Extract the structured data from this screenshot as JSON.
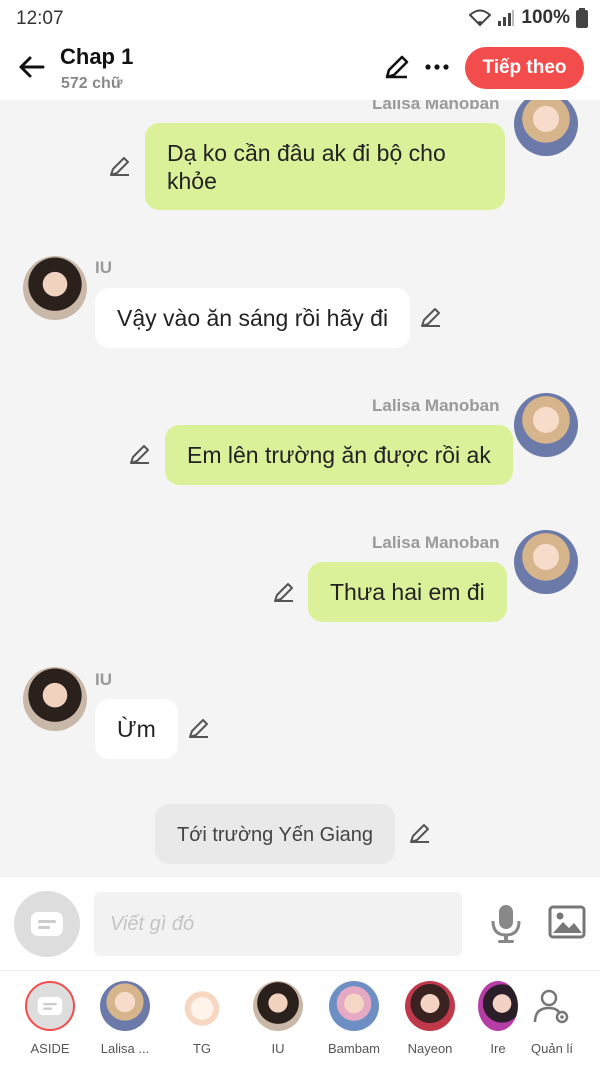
{
  "status": {
    "time": "12:07",
    "battery": "100%"
  },
  "header": {
    "title": "Chap 1",
    "word_count": "572 chữ",
    "next_label": "Tiếp theo"
  },
  "messages": [
    {
      "side": "right",
      "sender": "Lalisa Manoban",
      "text": "Dạ ko cần đâu ak đi bộ cho khỏe"
    },
    {
      "side": "left",
      "sender": "IU",
      "text": "Vậy vào ăn sáng rồi hãy đi"
    },
    {
      "side": "right",
      "sender": "Lalisa Manoban",
      "text": "Em lên trường ăn được rồi ak"
    },
    {
      "side": "right",
      "sender": "Lalisa Manoban",
      "text": "Thưa hai em đi"
    },
    {
      "side": "left",
      "sender": "IU",
      "text": "Ừm"
    },
    {
      "side": "aside",
      "text": "Tới trường Yến Giang"
    }
  ],
  "input": {
    "placeholder": "Viết gì đó"
  },
  "characters": [
    {
      "label": "ASIDE"
    },
    {
      "label": "Lalisa ..."
    },
    {
      "label": "TG"
    },
    {
      "label": "IU"
    },
    {
      "label": "Bambam"
    },
    {
      "label": "Nayeon"
    },
    {
      "label": "Ire"
    },
    {
      "label": "Quản lí"
    }
  ],
  "colors": {
    "accent": "#f24c4c",
    "my_bubble": "#dbf199",
    "other_bubble": "#ffffff",
    "aside_bubble": "#e9e9e9"
  }
}
